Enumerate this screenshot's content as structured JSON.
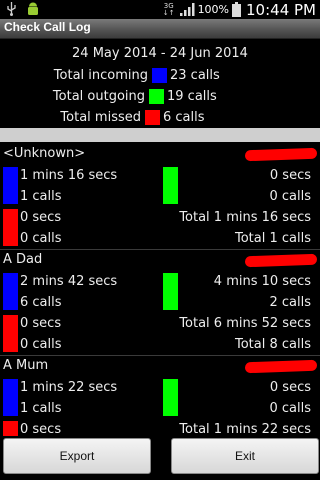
{
  "status_bar": {
    "network_top": "3G",
    "network_bottom": "↓↑",
    "battery_percent": "100%",
    "time": "10:44 PM",
    "icons": [
      "usb-icon",
      "android-notification-icon",
      "signal-icon",
      "battery-icon"
    ]
  },
  "app": {
    "title": "Check Call Log"
  },
  "summary": {
    "date_range": "24 May 2014 - 24 Jun 2014",
    "incoming": {
      "label": "Total incoming",
      "value": "23 calls",
      "color": "#0000ff"
    },
    "outgoing": {
      "label": "Total outgoing",
      "value": "19 calls",
      "color": "#00ff00"
    },
    "missed": {
      "label": "Total missed",
      "value": "6 calls",
      "color": "#ff0000"
    }
  },
  "contacts": [
    {
      "name": "<Unknown>",
      "incoming_time": "1 mins 16 secs",
      "incoming_calls": "1 calls",
      "outgoing_time": "0 secs",
      "outgoing_calls": "0 calls",
      "missed_time": "0 secs",
      "missed_calls": "0 calls",
      "total_time": "Total 1 mins 16 secs",
      "total_calls": "Total 1 calls"
    },
    {
      "name": "A Dad",
      "incoming_time": "2 mins 42 secs",
      "incoming_calls": "6 calls",
      "outgoing_time": "4 mins 10 secs",
      "outgoing_calls": "2 calls",
      "missed_time": "0 secs",
      "missed_calls": "0 calls",
      "total_time": "Total 6 mins 52 secs",
      "total_calls": "Total 8 calls"
    },
    {
      "name": "A Mum",
      "incoming_time": "1 mins 22 secs",
      "incoming_calls": "1 calls",
      "outgoing_time": "0 secs",
      "outgoing_calls": "0 calls",
      "missed_time": "0 secs",
      "missed_calls": "",
      "total_time": "Total 1 mins 22 secs",
      "total_calls": ""
    }
  ],
  "buttons": {
    "export": "Export",
    "exit": "Exit"
  }
}
